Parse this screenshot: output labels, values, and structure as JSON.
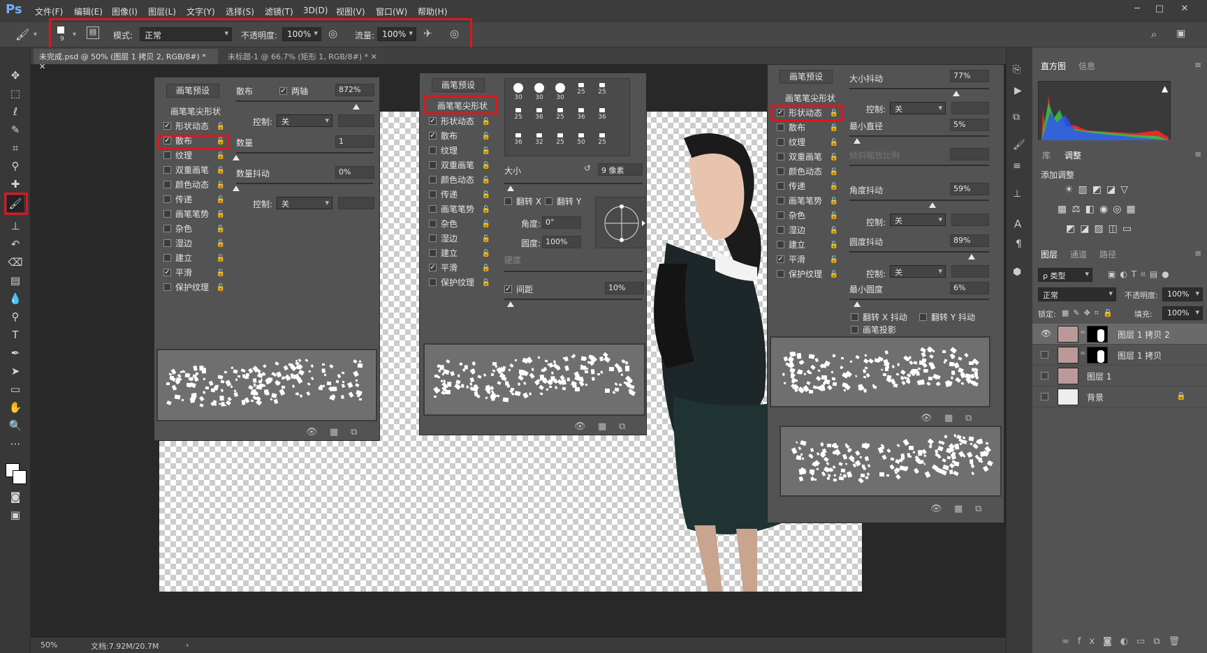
{
  "app": {
    "logo": "Ps",
    "menus": [
      "文件(F)",
      "编辑(E)",
      "图像(I)",
      "图层(L)",
      "文字(Y)",
      "选择(S)",
      "滤镜(T)",
      "3D(D)",
      "视图(V)",
      "窗口(W)",
      "帮助(H)"
    ],
    "window_controls": [
      "─",
      "□",
      "✕"
    ]
  },
  "options": {
    "brush_size": "9",
    "mode_label": "模式:",
    "mode_value": "正常",
    "opacity_label": "不透明度:",
    "opacity_value": "100%",
    "flow_label": "流量:",
    "flow_value": "100%"
  },
  "tabs": [
    "未完成.psd @ 50% (图层 1 拷贝 2, RGB/8#) *",
    "未标题-1 @ 66.7% (矩形 1, RGB/8#) *"
  ],
  "status": {
    "zoom": "50%",
    "doc": "文档:7.92M/20.7M"
  },
  "brush_settings": {
    "presets_btn": "画笔预设",
    "tip_shape": "画笔笔尖形状",
    "items": [
      "形状动态",
      "散布",
      "纹理",
      "双重画笔",
      "颜色动态",
      "传递",
      "画笔笔势",
      "杂色",
      "湿边",
      "建立",
      "平滑",
      "保护纹理"
    ]
  },
  "panel1": {
    "checked": [
      true,
      true,
      false,
      false,
      false,
      false,
      false,
      false,
      false,
      false,
      true,
      false
    ],
    "scatter_label": "散布",
    "both_axes": "两轴",
    "scatter_value": "872%",
    "control_label": "控制:",
    "control_value": "关",
    "count_label": "数量",
    "count_value": "1",
    "count_jitter_label": "数量抖动",
    "count_jitter_value": "0%",
    "control2_value": "关"
  },
  "panel2": {
    "checked": [
      true,
      true,
      false,
      false,
      false,
      false,
      false,
      false,
      false,
      false,
      true,
      false
    ],
    "tip_numbers": [
      "30",
      "30",
      "30",
      "25",
      "25",
      "25",
      "36",
      "25",
      "36",
      "36",
      "36",
      "32",
      "25",
      "50",
      "25"
    ],
    "size_label": "大小",
    "size_value": "9 像素",
    "flip_x": "翻转 X",
    "flip_y": "翻转 Y",
    "angle_label": "角度:",
    "angle_value": "0°",
    "roundness_label": "圆度:",
    "roundness_value": "100%",
    "hardness_label": "硬度",
    "spacing_label": "间距",
    "spacing_value": "10%"
  },
  "panel3": {
    "checked": [
      true,
      false,
      false,
      false,
      false,
      false,
      false,
      false,
      false,
      false,
      true,
      false
    ],
    "size_jitter_label": "大小抖动",
    "size_jitter_value": "77%",
    "control_label": "控制:",
    "control_value": "关",
    "min_diameter_label": "最小直径",
    "min_diameter_value": "5%",
    "tilt_scale_label": "倾斜缩放比例",
    "angle_jitter_label": "角度抖动",
    "angle_jitter_value": "59%",
    "control2_value": "关",
    "roundness_jitter_label": "圆度抖动",
    "roundness_jitter_value": "89%",
    "control3_value": "关",
    "min_roundness_label": "最小圆度",
    "min_roundness_value": "6%",
    "flip_x_jitter": "翻转 X 抖动",
    "flip_y_jitter": "翻转 Y 抖动",
    "brush_projection": "画笔投影"
  },
  "right": {
    "top_tabs": [
      "直方图",
      "信息"
    ],
    "mid_tabs": [
      "库",
      "调整"
    ],
    "add_adjust": "添加调整",
    "layer_tabs": [
      "图层",
      "通道",
      "路径"
    ],
    "kind_label": "ρ 类型",
    "blend_mode": "正常",
    "opacity_label": "不透明度:",
    "opacity_value": "100%",
    "lock_label": "锁定:",
    "fill_label": "填充:",
    "fill_value": "100%",
    "layers": [
      "图层 1 拷贝 2",
      "图层 1 拷贝",
      "图层 1",
      "背景"
    ]
  },
  "colors": {
    "accent_red": "#e3141b",
    "ui_dark": "#383838",
    "ui_mid": "#535353",
    "histogram_red": "#ff2a2a",
    "histogram_green": "#22d04a",
    "histogram_blue": "#3050ff"
  }
}
